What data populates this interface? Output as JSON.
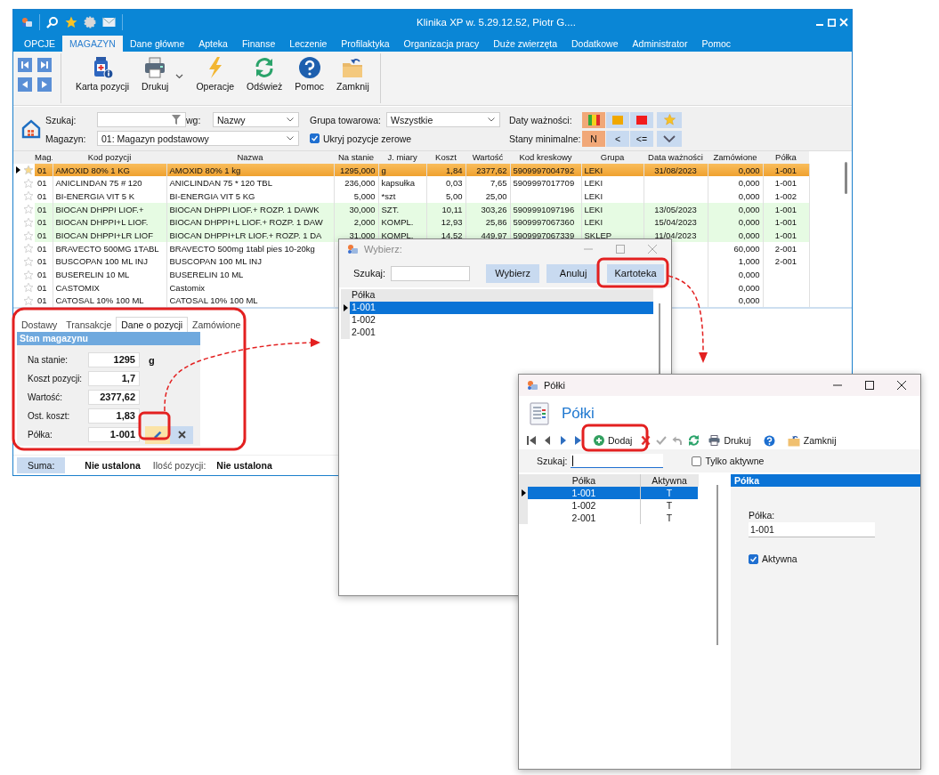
{
  "main_window": {
    "title": "Klinika XP w. 5.29.12.52, Piotr G....",
    "menu": [
      {
        "label": "OPCJE",
        "selected": false
      },
      {
        "label": "MAGAZYN",
        "selected": true
      },
      {
        "label": "Dane główne",
        "selected": false
      },
      {
        "label": "Apteka",
        "selected": false
      },
      {
        "label": "Finanse",
        "selected": false
      },
      {
        "label": "Leczenie",
        "selected": false
      },
      {
        "label": "Profilaktyka",
        "selected": false
      },
      {
        "label": "Organizacja pracy",
        "selected": false
      },
      {
        "label": "Duże zwierzęta",
        "selected": false
      },
      {
        "label": "Dodatkowe",
        "selected": false
      },
      {
        "label": "Administrator",
        "selected": false
      },
      {
        "label": "Pomoc",
        "selected": false
      }
    ],
    "toolbar": [
      {
        "kind": "card",
        "label": "Karta pozycji",
        "dropdown": false
      },
      {
        "kind": "print",
        "label": "Drukuj",
        "dropdown": true
      },
      {
        "kind": "operations",
        "label": "Operacje",
        "dropdown": false
      },
      {
        "kind": "refresh",
        "label": "Odśwież",
        "dropdown": false
      },
      {
        "kind": "help",
        "label": "Pomoc",
        "dropdown": false
      },
      {
        "kind": "close",
        "label": "Zamknij",
        "dropdown": false
      }
    ],
    "filters": {
      "search_label": "Szukaj:",
      "by_label": "wg:",
      "by_value": "Nazwy",
      "group_label": "Grupa towarowa:",
      "group_value": "Wszystkie",
      "warehouse_label": "Magazyn:",
      "warehouse_value": "01: Magazyn podstawowy",
      "hide_zero": {
        "label": "Ukryj pozycje zerowe",
        "checked": true
      },
      "expiry_label": "Daty ważności:",
      "expiry_buttons": [
        {
          "kind": "multi",
          "selected": true
        },
        {
          "kind": "amber",
          "selected": false
        },
        {
          "kind": "red",
          "selected": false
        }
      ],
      "minimum_label": "Stany minimalne:",
      "minimum_buttons": [
        {
          "label": "N",
          "selected": true
        },
        {
          "label": "<",
          "selected": false
        },
        {
          "label": "<=",
          "selected": false
        }
      ]
    },
    "table": {
      "columns": [
        "Mag.",
        "Kod pozycji",
        "Nazwa",
        "Na stanie",
        "J. miary",
        "Koszt",
        "Wartość",
        "Kod kreskowy",
        "Grupa",
        "Data ważności",
        "Zamówione",
        "Półka"
      ],
      "rows": [
        {
          "selected": true,
          "cells": [
            "01",
            "AMOXID 80% 1 KG",
            "AMOXID 80% 1 kg",
            "1295,000",
            "g",
            "1,84",
            "2377,62",
            "5909997004792",
            "LEKI",
            "31/08/2023",
            "0,000",
            "1-001"
          ]
        },
        {
          "selected": false,
          "highlighted": false,
          "cells": [
            "01",
            "ANICLINDAN 75  # 120",
            "ANICLINDAN 75  * 120 TBL",
            "236,000",
            "kapsułka",
            "0,03",
            "7,65",
            "5909997017709",
            "LEKI",
            null,
            "0,000",
            "1-001"
          ]
        },
        {
          "selected": false,
          "highlighted": false,
          "cells": [
            "01",
            "BI-ENERGIA VIT   5 K",
            "BI-ENERGIA VIT   5 KG",
            "5,000",
            "*szt",
            "5,00",
            "25,00",
            null,
            "LEKI",
            null,
            "0,000",
            "1-002"
          ]
        },
        {
          "selected": false,
          "highlighted": true,
          "cells": [
            "01",
            "BIOCAN DHPPI LIOF.+",
            "BIOCAN DHPPI LIOF.+ ROZP. 1 DAWK",
            "30,000",
            "SZT.",
            "10,11",
            "303,26",
            "5909991097196",
            "LEKI",
            "13/05/2023",
            "0,000",
            "1-001"
          ]
        },
        {
          "selected": false,
          "highlighted": true,
          "cells": [
            "01",
            "BIOCAN DHPPI+L LIOF.",
            "BIOCAN DHPPI+L LIOF.+ ROZP. 1 DAW",
            "2,000",
            "KOMPL.",
            "12,93",
            "25,86",
            "5909997067360",
            "LEKI",
            "15/04/2023",
            "0,000",
            "1-001"
          ]
        },
        {
          "selected": false,
          "highlighted": true,
          "cells": [
            "01",
            "BIOCAN DHPPI+LR LIOF",
            "BIOCAN DHPPI+LR LIOF.+ ROZP. 1 DA",
            "31,000",
            "KOMPL.",
            "14,52",
            "449,97",
            "5909997067339",
            "SKLEP",
            "11/04/2023",
            "0,000",
            "1-001"
          ]
        },
        {
          "selected": false,
          "highlighted": false,
          "cells": [
            "01",
            "BRAVECTO 500MG 1TABL",
            "BRAVECTO 500mg 1tabl pies 10-20kg",
            null,
            null,
            null,
            null,
            null,
            null,
            null,
            "60,000",
            "2-001"
          ]
        },
        {
          "selected": false,
          "highlighted": false,
          "cells": [
            "01",
            "BUSCOPAN 100 ML INJ",
            "BUSCOPAN 100 ML INJ",
            null,
            null,
            null,
            null,
            null,
            null,
            null,
            "1,000",
            "2-001"
          ]
        },
        {
          "selected": false,
          "highlighted": false,
          "cells": [
            "01",
            "BUSERELIN 10 ML",
            "BUSERELIN 10 ML",
            null,
            null,
            null,
            null,
            null,
            null,
            null,
            "0,000",
            null
          ]
        },
        {
          "selected": false,
          "highlighted": false,
          "cells": [
            "01",
            "CASTOMIX",
            "Castomix",
            null,
            null,
            null,
            null,
            null,
            null,
            null,
            "0,000",
            null
          ]
        },
        {
          "selected": false,
          "highlighted": false,
          "cells": [
            "01",
            "CATOSAL 10% 100 ML",
            "CATOSAL 10% 100 ML",
            null,
            null,
            null,
            null,
            null,
            null,
            null,
            "0,000",
            null
          ]
        }
      ]
    },
    "detail_tabs": [
      {
        "label": "Dostawy",
        "selected": false
      },
      {
        "label": "Transakcje",
        "selected": false
      },
      {
        "label": "Dane o pozycji",
        "selected": true
      },
      {
        "label": "Zamówione",
        "selected": false
      }
    ],
    "stock_group": {
      "title": "Stan magazynu",
      "fields": [
        {
          "kind": "plain",
          "label": "Na stanie:",
          "value": "1295",
          "unit": "g"
        },
        {
          "kind": "plain",
          "label": "Koszt pozycji:",
          "value": "1,7"
        },
        {
          "kind": "plain",
          "label": "Wartość:",
          "value": "2377,62"
        },
        {
          "kind": "plain",
          "label": "Ost. koszt:",
          "value": "1,83"
        },
        {
          "kind": "picker",
          "label": "Półka:",
          "value": "1-001"
        }
      ]
    },
    "status_bar": {
      "sum_label": "Suma:",
      "sum_value": "Nie ustalona",
      "count_label": "Ilość pozycji:",
      "count_value": "Nie ustalona"
    }
  },
  "picker_dialog": {
    "title": "Wybierz:",
    "search_label": "Szukaj:",
    "buttons": [
      "Wybierz",
      "Anuluj",
      "Kartoteka"
    ],
    "column": "Półka",
    "rows": [
      {
        "value": "1-001",
        "selected": true
      },
      {
        "value": "1-002",
        "selected": false
      },
      {
        "value": "2-001",
        "selected": false
      }
    ]
  },
  "shelves_window": {
    "title": "Półki",
    "heading": "Półki",
    "add_label": "Dodaj",
    "print_label": "Drukuj",
    "close_label": "Zamknij",
    "search_label": "Szukaj:",
    "active_only": {
      "label": "Tylko aktywne",
      "checked": false
    },
    "columns": [
      "Półka",
      "Aktywna"
    ],
    "rows": [
      {
        "shelf": "1-001",
        "active": "T",
        "selected": true
      },
      {
        "shelf": "1-002",
        "active": "T",
        "selected": false
      },
      {
        "shelf": "2-001",
        "active": "T",
        "selected": false
      }
    ],
    "detail": {
      "title": "Półka",
      "field_label": "Półka:",
      "field_value": "1-001",
      "active": {
        "label": "Aktywna",
        "checked": true
      }
    }
  }
}
